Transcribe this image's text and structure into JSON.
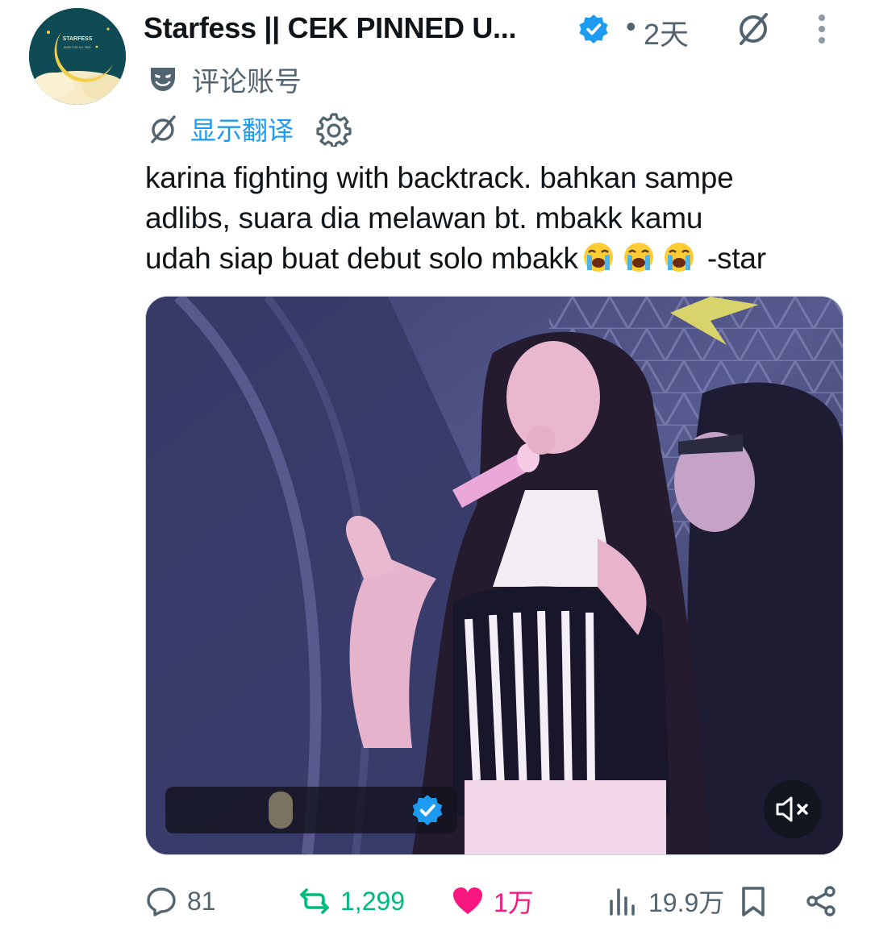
{
  "header": {
    "display_name": "Starfess || CEK PINNED U...",
    "dot": "•",
    "timestamp": "2天",
    "avatar_text": "STARFESS",
    "avatar_subtext": "BASE FOR ALL SIDE"
  },
  "label": {
    "text": "评论账号",
    "icon": "mask-icon"
  },
  "translate": {
    "label": "显示翻译",
    "icons": [
      "grok-icon",
      "gear-icon"
    ]
  },
  "tweet": {
    "line1": "karina fighting with backtrack. bahkan sampe",
    "line2": "adlibs, suara dia melawan bt. mbakk kamu",
    "line3_before": "udah siap buat debut solo mbakk",
    "emoji": "loudly-crying-face",
    "line3_after": " -star"
  },
  "media": {
    "type": "video",
    "mute_icon": "speaker-muted-icon"
  },
  "actions": {
    "reply_count": "81",
    "repost_count": "1,299",
    "like_count": "1万",
    "views_count": "19.9万"
  },
  "colors": {
    "accent": "#1d9bf0",
    "repost": "#00ba7c",
    "like": "#f91880",
    "muted_text": "#536471",
    "text": "#0f1419"
  }
}
